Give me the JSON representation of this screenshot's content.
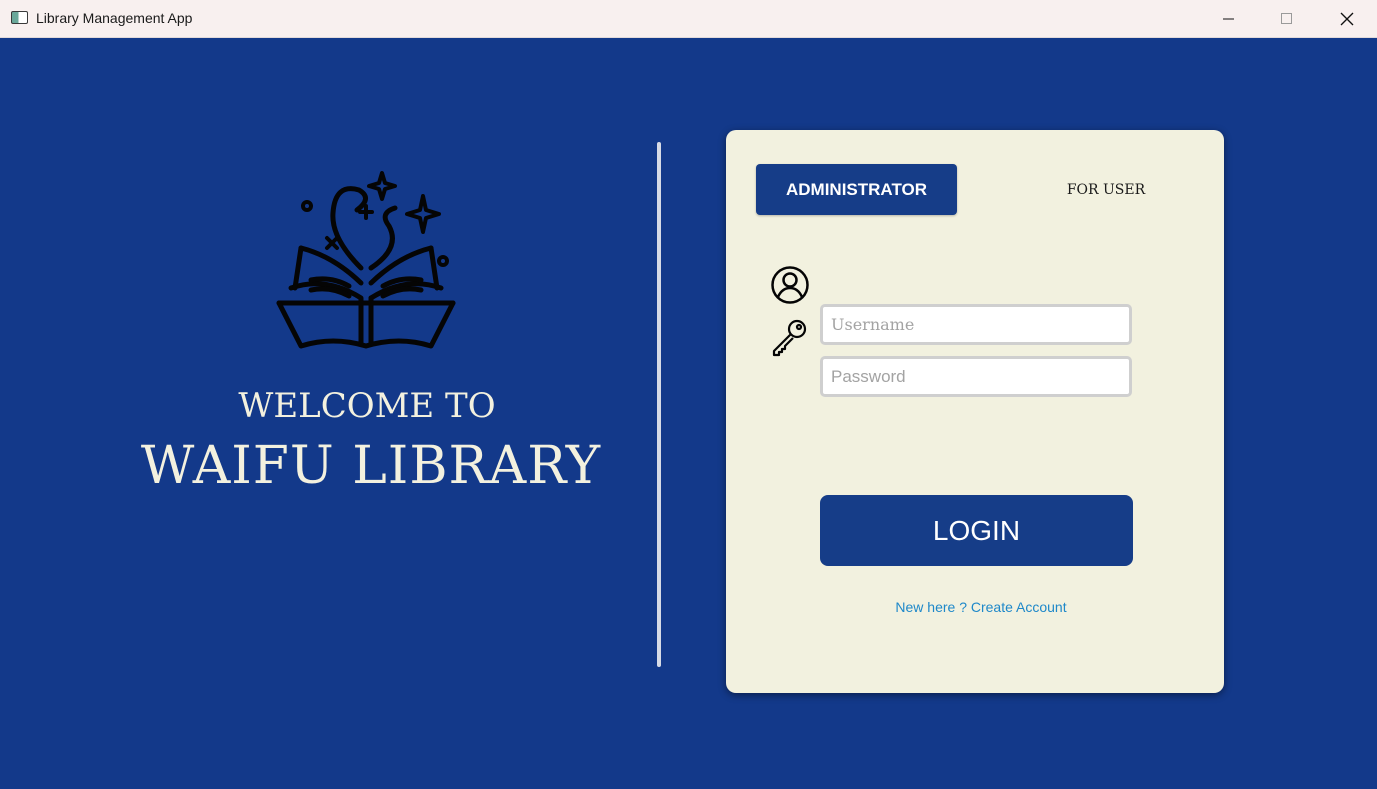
{
  "window": {
    "title": "Library Management App",
    "controls": [
      "minimize-icon",
      "maximize-icon",
      "close-icon"
    ]
  },
  "hero": {
    "welcome": "WELCOME TO",
    "library_name": "WAIFU LIBRARY",
    "logo_icon": "magic-book-icon"
  },
  "login": {
    "tab_admin": "ADMINISTRATOR",
    "tab_user": "FOR USER",
    "active_tab": "ADMINISTRATOR",
    "username_placeholder": "Username",
    "username_value": "",
    "password_placeholder": "Password",
    "password_value": "",
    "username_icon": "user-circle-icon",
    "password_icon": "key-icon",
    "login_label": "LOGIN",
    "create_account_link": "New here ? Create Account"
  },
  "colors": {
    "background": "#13398a",
    "card": "#f2f1df",
    "accent": "#163d88",
    "link": "#1e88c9",
    "hero_text": "#f3f1df"
  }
}
